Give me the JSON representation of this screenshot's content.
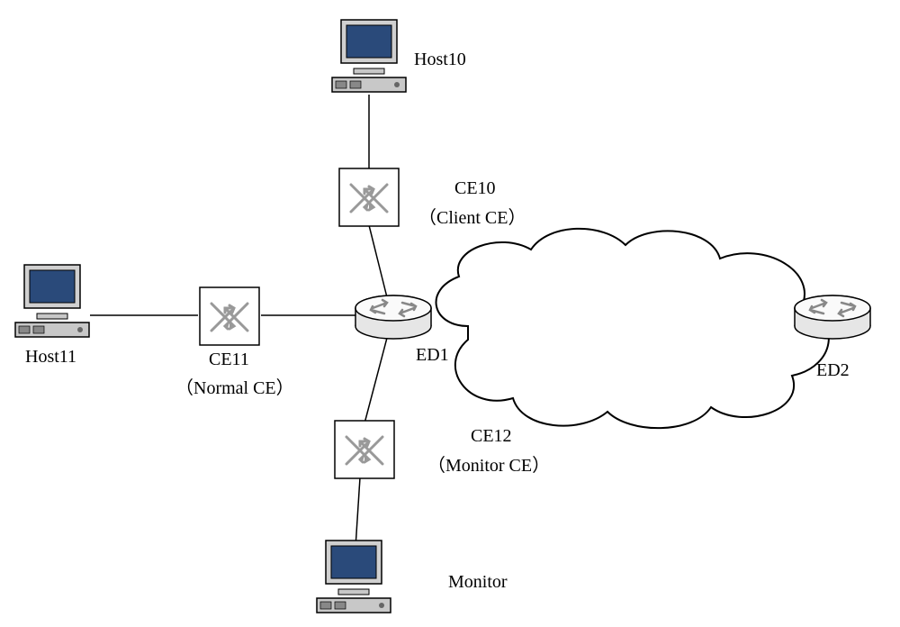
{
  "labels": {
    "host10": "Host10",
    "ce10_line1": "CE10",
    "ce10_line2": "（Client CE）",
    "host11": "Host11",
    "ce11_line1": "CE11",
    "ce11_line2": "（Normal CE）",
    "ed1": "ED1",
    "ed2": "ED2",
    "ce12_line1": "CE12",
    "ce12_line2": "（Monitor CE）",
    "monitor": "Monitor"
  },
  "iconNames": {
    "host": "computer-icon",
    "switch": "network-switch-icon",
    "router": "router-icon",
    "cloud": "network-cloud-icon"
  }
}
